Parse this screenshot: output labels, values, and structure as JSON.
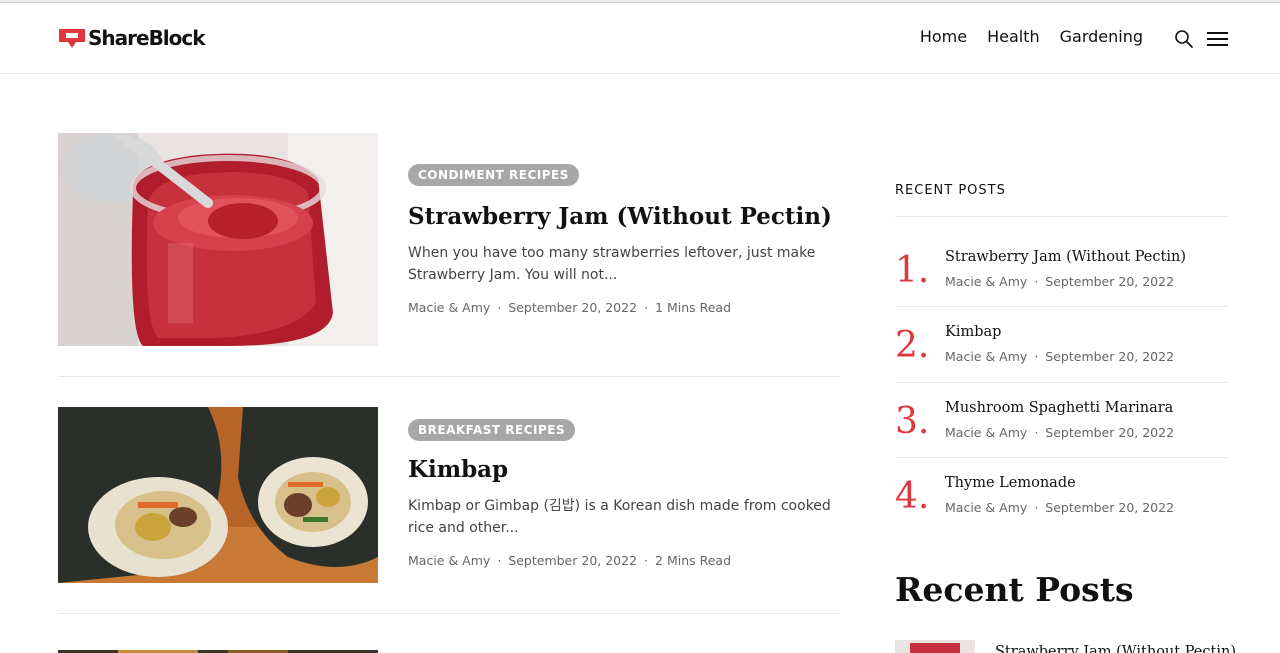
{
  "site": {
    "logo_text": "ShareBlock",
    "accent": "#e0363d"
  },
  "nav": {
    "items": [
      "Home",
      "Health",
      "Gardening"
    ]
  },
  "icons": {
    "search": "search-icon",
    "menu": "hamburger-menu-icon"
  },
  "posts": [
    {
      "category": "CONDIMENT RECIPES",
      "title": "Strawberry Jam (Without Pectin)",
      "excerpt": "When you have too many strawberries leftover, just make Strawberry Jam. You will not...",
      "author": "Macie & Amy",
      "date": "September 20, 2022",
      "read_time": "1 Mins Read"
    },
    {
      "category": "BREAKFAST RECIPES",
      "title": "Kimbap",
      "excerpt": "Kimbap or Gimbap (김밥) is a Korean dish made from cooked rice and other...",
      "author": "Macie & Amy",
      "date": "September 20, 2022",
      "read_time": "2 Mins Read"
    }
  ],
  "sidebar": {
    "heading": "RECENT POSTS",
    "items": [
      {
        "num": "1.",
        "title": "Strawberry Jam (Without Pectin)",
        "author": "Macie & Amy",
        "date": "September 20, 2022"
      },
      {
        "num": "2.",
        "title": "Kimbap",
        "author": "Macie & Amy",
        "date": "September 20, 2022"
      },
      {
        "num": "3.",
        "title": "Mushroom Spaghetti Marinara",
        "author": "Macie & Amy",
        "date": "September 20, 2022"
      },
      {
        "num": "4.",
        "title": "Thyme Lemonade",
        "author": "Macie & Amy",
        "date": "September 20, 2022"
      }
    ],
    "widget2_heading": "Recent Posts",
    "widget2_first_title": "Strawberry Jam (Without Pectin)"
  }
}
